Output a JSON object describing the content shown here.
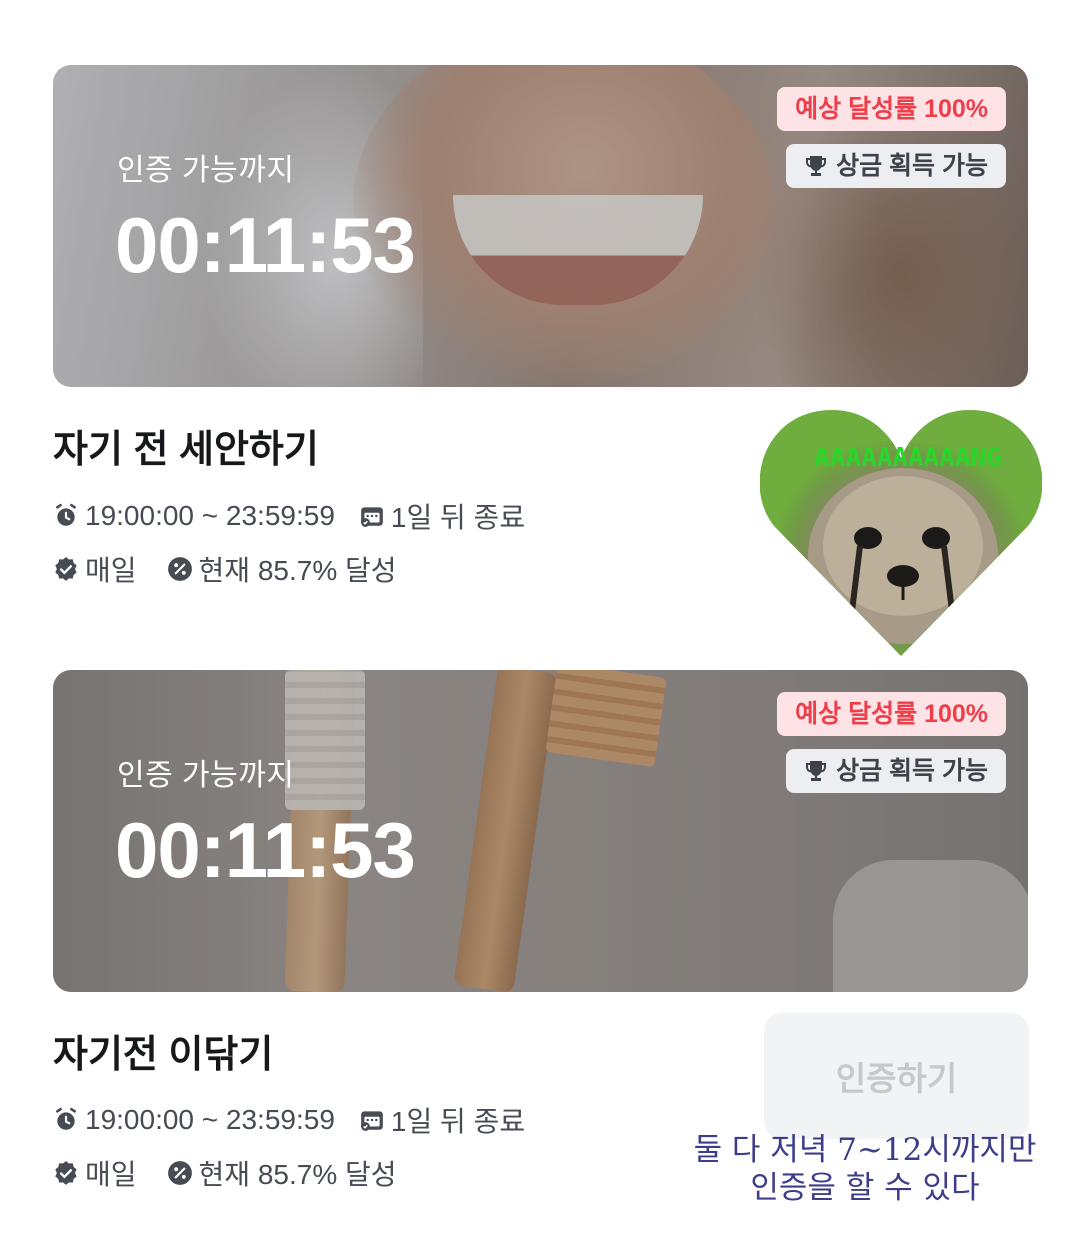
{
  "cards": [
    {
      "label": "인증 가능까지",
      "timer": "00:11:53",
      "rate_badge": "예상 달성률 100%",
      "prize_badge": "상금 획득 가능",
      "title": "자기 전 세안하기",
      "time_range": "19:00:00 ~ 23:59:59",
      "end_info": "1일 뒤 종료",
      "frequency": "매일",
      "progress": "현재 85.7% 달성"
    },
    {
      "label": "인증 가능까지",
      "timer": "00:11:53",
      "rate_badge": "예상 달성률 100%",
      "prize_badge": "상금 획득 가능",
      "title": "자기전 이닦기",
      "time_range": "19:00:00 ~ 23:59:59",
      "end_info": "1일 뒤 종료",
      "frequency": "매일",
      "progress": "현재 85.7% 달성"
    }
  ],
  "sticker": {
    "caption": "AAAAAAAAAANG"
  },
  "verify_button": "인증하기",
  "note": {
    "line1": "둘 다 저녁 7~12시까지만",
    "line2": "인증을 할 수 있다"
  },
  "colors": {
    "rate_text": "#ee3e49",
    "rate_bg": "#fde3e5",
    "prize_bg": "#edeef1",
    "note": "#3e3d8a",
    "sticker_text": "#2bd52b"
  },
  "icons": [
    "alarm-clock-icon",
    "calendar-icon",
    "verified-badge-icon",
    "percent-icon",
    "trophy-icon"
  ]
}
